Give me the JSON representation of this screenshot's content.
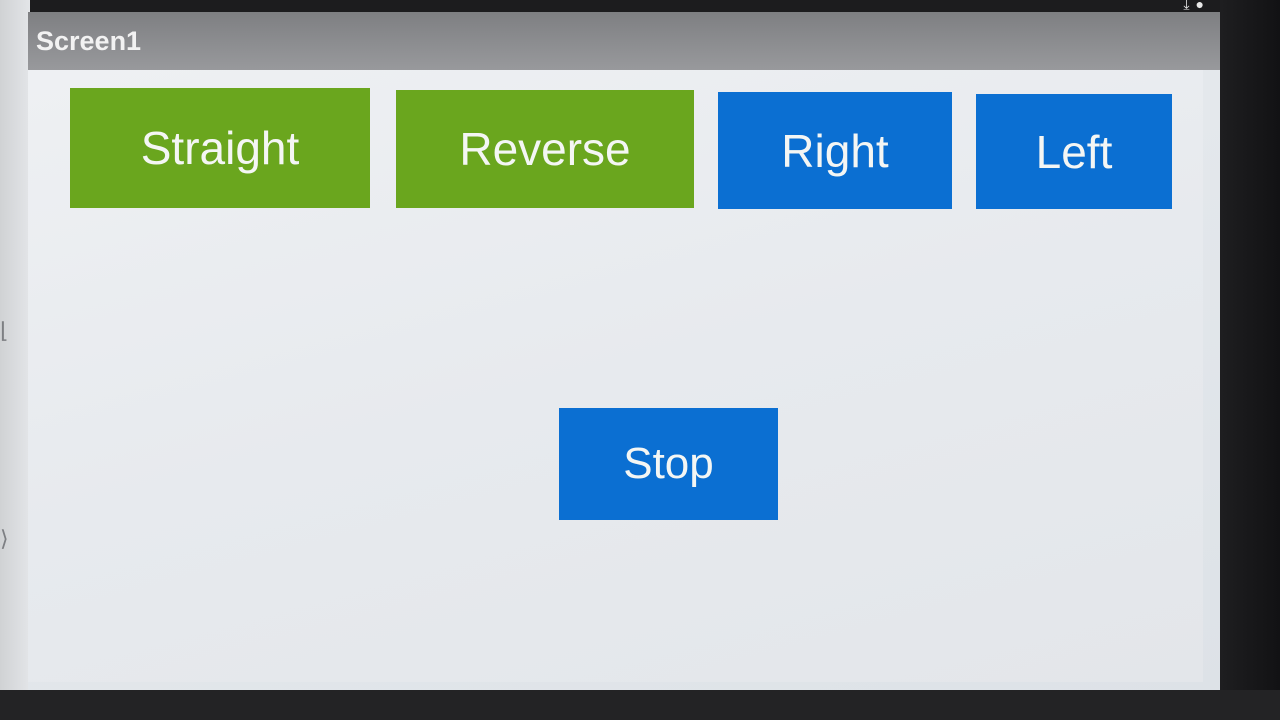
{
  "screen": {
    "title": "Screen1"
  },
  "buttons": {
    "straight": {
      "label": "Straight",
      "color": "#6aa61e"
    },
    "reverse": {
      "label": "Reverse",
      "color": "#6aa61e"
    },
    "right": {
      "label": "Right",
      "color": "#0b6fd2"
    },
    "left": {
      "label": "Left",
      "color": "#0b6fd2"
    },
    "stop": {
      "label": "Stop",
      "color": "#0b6fd2"
    }
  },
  "icons": [
    "download-icon",
    "chat-bubble-icon"
  ]
}
